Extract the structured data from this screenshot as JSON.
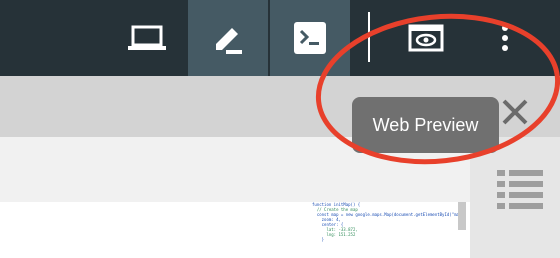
{
  "toolbar": {
    "buttons": [
      {
        "name": "laptop",
        "icon": "laptop-icon"
      },
      {
        "name": "edit",
        "icon": "pencil-icon"
      },
      {
        "name": "terminal",
        "icon": "terminal-icon"
      },
      {
        "name": "web-preview",
        "icon": "web-preview-icon"
      },
      {
        "name": "more",
        "icon": "more-vert-icon"
      }
    ]
  },
  "tooltip": {
    "text": "Web Preview"
  },
  "minimap": {
    "lines": [
      "function initMap() {",
      "  // Create the map",
      "  const map = new google.maps.Map(document.getElementById(\"map\"), {",
      "    zoom: 4,",
      "    center: {",
      "      lat: -33.872,",
      "      lng: 151.252",
      "    }"
    ]
  },
  "colors": {
    "toolbar_bg": "#263238",
    "active_button_bg": "#455a64",
    "tooltip_bg": "#707070",
    "callout_red": "#e8402b"
  }
}
